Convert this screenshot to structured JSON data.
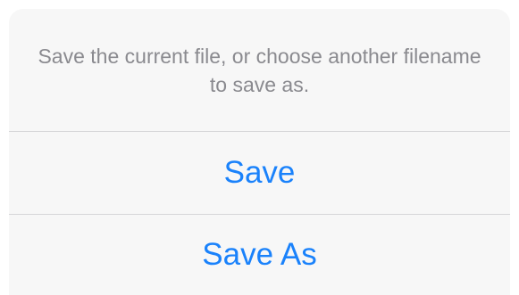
{
  "dialog": {
    "message": "Save the current file, or choose another filename to save as.",
    "actions": [
      {
        "label": "Save"
      },
      {
        "label": "Save As"
      }
    ]
  },
  "colors": {
    "sheet_background": "#f7f7f7",
    "message_text": "#8a8a8f",
    "action_text": "#1a82fb",
    "divider": "#d6d6d9"
  }
}
